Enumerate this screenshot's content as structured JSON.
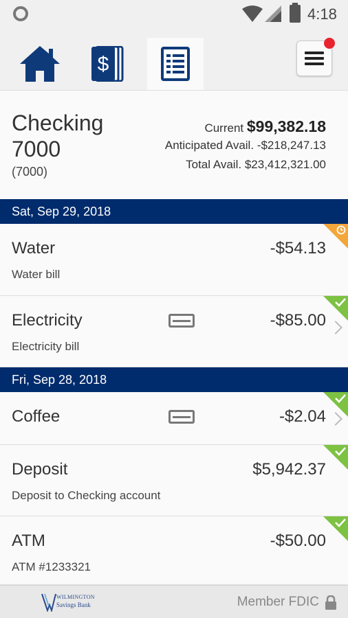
{
  "status_bar": {
    "time": "4:18"
  },
  "nav": {
    "tabs": [
      {
        "icon": "home-icon"
      },
      {
        "icon": "dollar-accounts-icon"
      },
      {
        "icon": "statement-icon",
        "active": true
      }
    ],
    "menu_icon": "hamburger-menu-icon",
    "notification_badge_color": "#e8232f"
  },
  "account": {
    "name": "Checking 7000",
    "number": "(7000)",
    "current_label": "Current",
    "current_value": "$99,382.18",
    "anticipated_label": "Anticipated Avail.",
    "anticipated_value": "-$218,247.13",
    "total_label": "Total Avail.",
    "total_value": "$23,412,321.00"
  },
  "groups": [
    {
      "date": "Sat, Sep 29, 2018",
      "transactions": [
        {
          "name": "Water",
          "description": "Water bill",
          "amount": "-$54.13",
          "status": "pending"
        },
        {
          "name": "Electricity",
          "description": "Electricity bill",
          "amount": "-$85.00",
          "status": "cleared",
          "card": true,
          "chevron": true
        }
      ]
    },
    {
      "date": "Fri, Sep 28, 2018",
      "transactions": [
        {
          "name": "Coffee",
          "description": "",
          "amount": "-$2.04",
          "status": "cleared",
          "card": true,
          "chevron": true
        },
        {
          "name": "Deposit",
          "description": "Deposit to Checking account",
          "amount": "$5,942.37",
          "status": "cleared"
        },
        {
          "name": "ATM",
          "description": "ATM #1233321",
          "amount": "-$50.00",
          "status": "cleared"
        }
      ]
    }
  ],
  "footer": {
    "logo_line1": "WILMINGTON",
    "logo_line2": "Savings Bank",
    "fdic": "Member FDIC"
  },
  "colors": {
    "header_blue": "#002b6c",
    "cleared_green": "#7dc242",
    "pending_orange": "#f3a63a"
  }
}
